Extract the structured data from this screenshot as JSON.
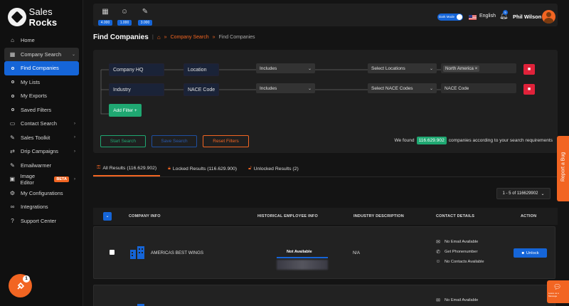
{
  "brand": {
    "name_part1": "Sales",
    "name_part2": "Rocks"
  },
  "sidebar": {
    "items": [
      {
        "label": "Home",
        "icon": "home-icon"
      },
      {
        "label": "Company Search",
        "icon": "building-icon"
      },
      {
        "label": "Find Companies",
        "icon": "dot-icon"
      },
      {
        "label": "My Lists",
        "icon": "dot-icon"
      },
      {
        "label": "My Exports",
        "icon": "dot-icon"
      },
      {
        "label": "Saved Filters",
        "icon": "dot-icon"
      },
      {
        "label": "Contact Search",
        "icon": "contact-icon"
      },
      {
        "label": "Sales Toolkit",
        "icon": "wrench-icon"
      },
      {
        "label": "Drip Campaigns",
        "icon": "drip-icon"
      },
      {
        "label": "Emailwarmer",
        "icon": "wrench-icon"
      },
      {
        "label": "Image Editor",
        "icon": "image-icon",
        "badge": "BETA"
      },
      {
        "label": "My Configurations",
        "icon": "gear-icon"
      },
      {
        "label": "Integrations",
        "icon": "link-icon"
      },
      {
        "label": "Support Center",
        "icon": "help-icon"
      }
    ],
    "fab_badge": "1"
  },
  "topbar": {
    "credits": [
      {
        "icon": "building-icon",
        "value": "4.000"
      },
      {
        "icon": "users-icon",
        "value": "1.000"
      },
      {
        "icon": "wrench-icon",
        "value": "3.000"
      }
    ],
    "dark_mode_label": "Dark Mode",
    "language": "English",
    "bell_count": "5",
    "user_name": "Phil Wilson"
  },
  "page": {
    "title": "Find Companies",
    "breadcrumb": {
      "link": "Company Search",
      "current": "Find Companies",
      "sep": "»"
    }
  },
  "filters": {
    "rows": [
      {
        "field": "Company HQ",
        "attribute": "Location",
        "operator": "Includes",
        "select": "Select Locations",
        "value": "North America"
      },
      {
        "field": "Industry",
        "attribute": "NACE Code",
        "operator": "Includes",
        "select": "Select NACE Codes",
        "value": "NACE Code"
      }
    ],
    "add_filter_label": "Add Filter +",
    "start_label": "Start Search",
    "save_label": "Save Search",
    "reset_label": "Reset Filters",
    "found_prefix": "We found",
    "found_count": "116.629.902",
    "found_suffix": "companies according to your search requirements"
  },
  "tabs": [
    {
      "label": "All Results (116.629.902)"
    },
    {
      "label": "Locked Results (116.629.900)"
    },
    {
      "label": "Unlocked Results (2)"
    }
  ],
  "pager": {
    "label": "1 - 5 of 116629902"
  },
  "table": {
    "headers": [
      "COMPANY INFO",
      "HISTORICAL EMPLOYEE INFO",
      "INDUSTRY DESCRIPTION",
      "CONTACT DETAILS",
      "ACTION"
    ],
    "rows": [
      {
        "company": "AMERICAS BEST WINGS",
        "employee": "Not Available",
        "industry": "N/A",
        "contacts": [
          "No Email Available",
          "Get Phonenumber",
          "No Contacts Available"
        ],
        "action": "Unlock"
      },
      {
        "contacts": [
          "No Email Available"
        ]
      }
    ]
  },
  "report_bug_label": "Report a Bug",
  "chat_widget": {
    "line1": "Leave us a",
    "line2": "Message"
  },
  "colors": {
    "accent_blue": "#1565d8",
    "accent_orange": "#f26522",
    "accent_green": "#1fa872",
    "danger": "#e0223a"
  }
}
